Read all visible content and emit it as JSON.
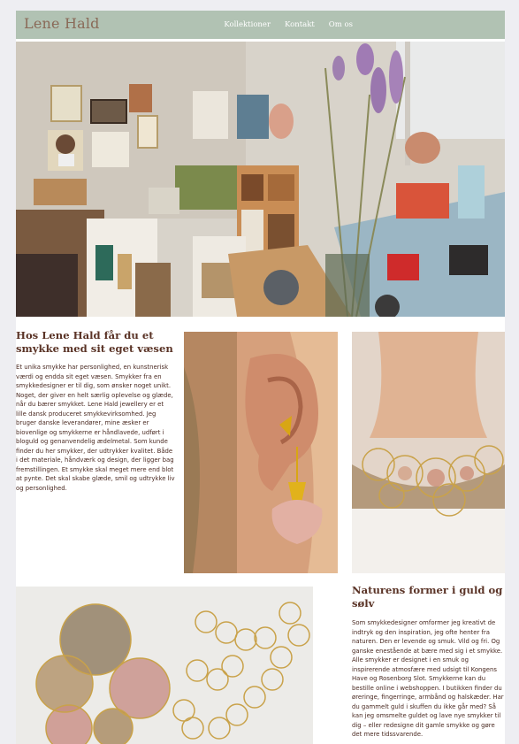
{
  "header": {
    "brand": "Lene Hald",
    "nav": [
      "Kollektioner",
      "Kontakt",
      "Om os"
    ]
  },
  "intro": {
    "heading": "Hos Lene Hald får du et smykke med sit eget væsen",
    "body": "Et unika smykke har personlighed, en kunstnerisk værdi og endda sit eget væsen. Smykker fra en smykkedesigner er til dig, som ønsker noget unikt. Noget, der giver en helt særlig oplevelse og glæde, når du bærer smykket. Lene Hald jewellery er et lille dansk produceret smykkevirksomhed. Jeg bruger danske leverandører, mine æsker er biovenlige og smykkerne er håndlavede, udført i bloguld og genanvendelig ædelmetal. Som kunde finder du her smykker, der udtrykker kvalitet. Både i det materiale, håndværk og design, der ligger bag fremstillingen. Et smykke skal meget mere end blot at pynte. Det skal skabe glæde, smil og udtrykke liv og personlighed."
  },
  "nature": {
    "heading": "Naturens former i guld og sølv",
    "body": "Som smykkedesigner omformer jeg kreativt de indtryk og den inspiration, jeg ofte henter fra naturen. Den er levende og smuk. Vild og fri. Og ganske enestående at bære med sig i et smykke. Alle smykker er designet i en smuk og inspirerende atmosfære med udsigt til Kongens Have og Rosenborg Slot. Smykkerne kan du bestille online i webshoppen. I butikken finder du øreringe, fingerringe, armbånd og halskæder. Har du gammelt guld i skuffen du ikke går med? Så kan jeg omsmelte guldet og lave nye smykker til dig – eller redesigne dit gamle smykke og gøre det mere tidssvarende."
  },
  "colors": {
    "header_bg": "#b1c2b3",
    "brand": "#8a6a58",
    "text": "#4a2a22",
    "page_bg": "#eeeef2"
  }
}
